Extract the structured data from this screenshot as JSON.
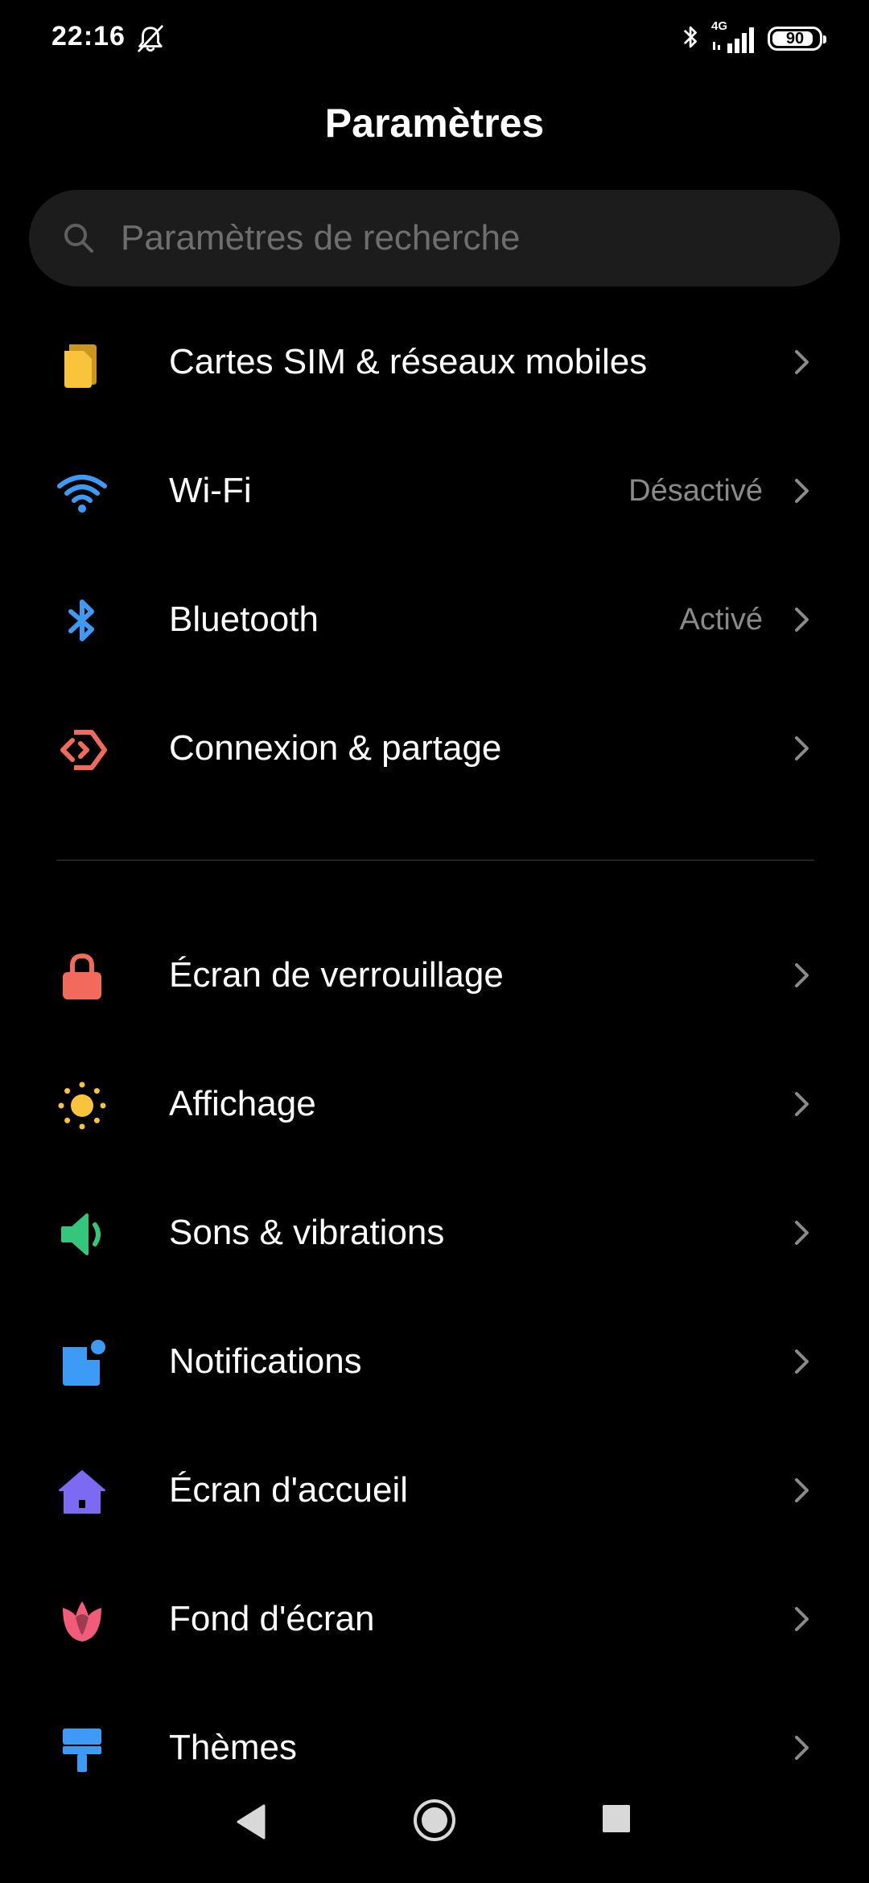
{
  "status_bar": {
    "time": "22:16",
    "network": "4G",
    "battery": "90",
    "battery_level": 0.9
  },
  "header": {
    "title": "Paramètres"
  },
  "search": {
    "placeholder": "Paramètres de recherche"
  },
  "settings": {
    "items": [
      {
        "label": "Cartes SIM & réseaux mobiles",
        "value": "",
        "icon": "sim-card-icon",
        "color": "#F9C33B"
      },
      {
        "label": "Wi-Fi",
        "value": "Désactivé",
        "icon": "wifi-icon",
        "color": "#3D9BF5"
      },
      {
        "label": "Bluetooth",
        "value": "Activé",
        "icon": "bluetooth-icon",
        "color": "#3D9BF5"
      },
      {
        "label": "Connexion & partage",
        "value": "",
        "icon": "connection-sharing-icon",
        "color": "#F26A5B"
      },
      {
        "label": "Écran de verrouillage",
        "value": "",
        "icon": "lock-icon",
        "color": "#F26A5B"
      },
      {
        "label": "Affichage",
        "value": "",
        "icon": "sun-icon",
        "color": "#F9C33B"
      },
      {
        "label": "Sons & vibrations",
        "value": "",
        "icon": "speaker-icon",
        "color": "#34C77B"
      },
      {
        "label": "Notifications",
        "value": "",
        "icon": "notification-icon",
        "color": "#3D9BF5"
      },
      {
        "label": "Écran d'accueil",
        "value": "",
        "icon": "home-icon",
        "color": "#7C6BF2"
      },
      {
        "label": "Fond d'écran",
        "value": "",
        "icon": "tulip-icon",
        "color": "#F25C7A"
      },
      {
        "label": "Thèmes",
        "value": "",
        "icon": "paint-roller-icon",
        "color": "#3D9BF5"
      }
    ]
  },
  "navigation": {
    "back": "back-icon",
    "home": "home-button-icon",
    "recents": "recents-icon"
  }
}
